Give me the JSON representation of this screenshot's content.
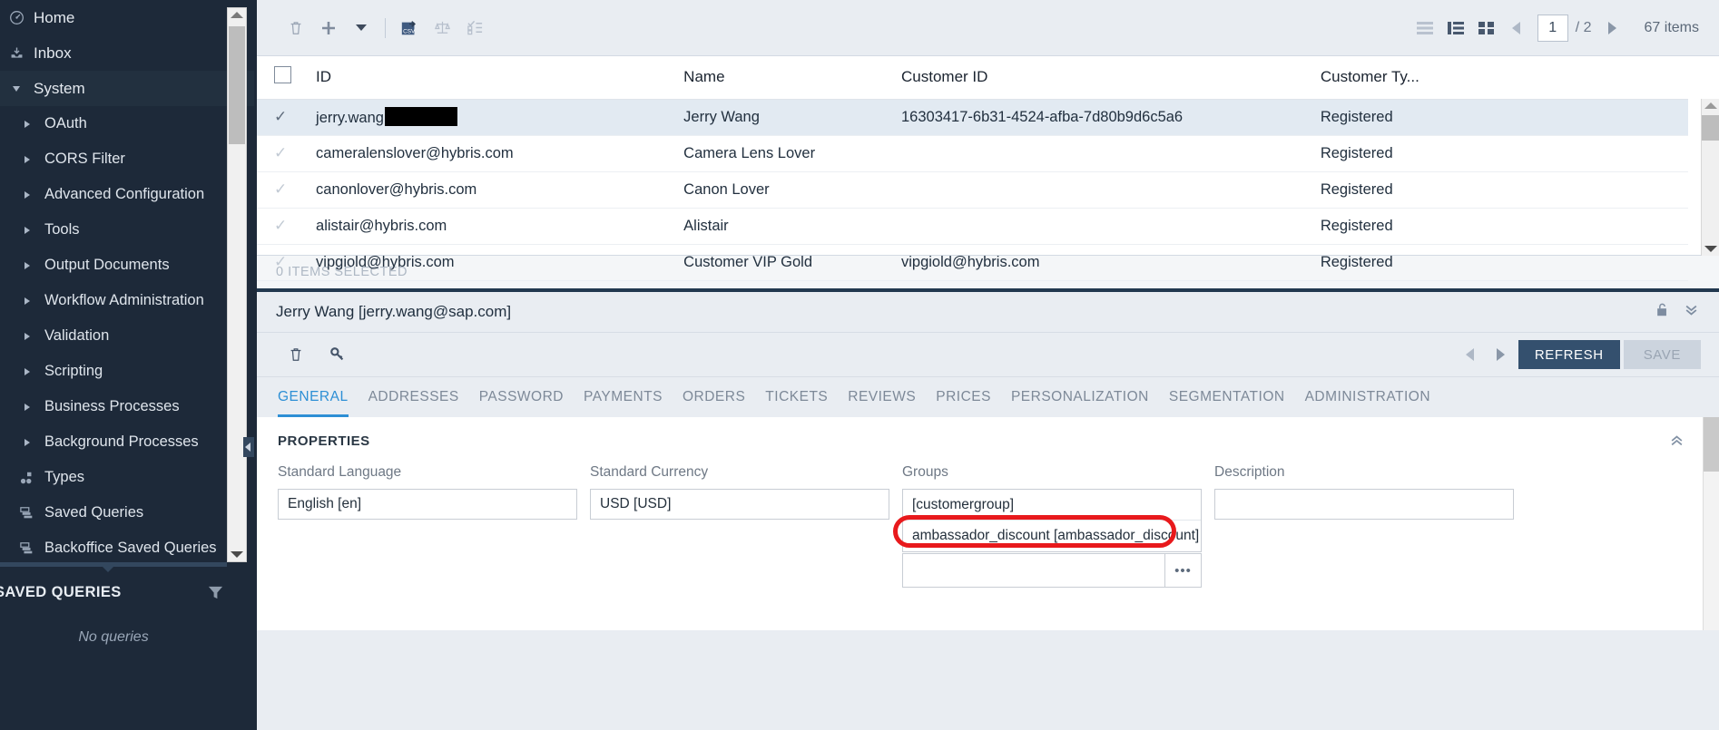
{
  "sidebar": {
    "items": [
      {
        "label": "Home",
        "icon": "home-icon",
        "level": 0,
        "expandable": false
      },
      {
        "label": "Inbox",
        "icon": "inbox-icon",
        "level": 0,
        "expandable": false
      },
      {
        "label": "System",
        "icon": "caret-down-icon",
        "level": 0,
        "expandable": true,
        "expanded": true
      },
      {
        "label": "OAuth",
        "icon": "caret-right-icon",
        "level": 1,
        "expandable": true
      },
      {
        "label": "CORS Filter",
        "icon": "caret-right-icon",
        "level": 1,
        "expandable": true
      },
      {
        "label": "Advanced Configuration",
        "icon": "caret-right-icon",
        "level": 1,
        "expandable": true
      },
      {
        "label": "Tools",
        "icon": "caret-right-icon",
        "level": 1,
        "expandable": true
      },
      {
        "label": "Output Documents",
        "icon": "caret-right-icon",
        "level": 1,
        "expandable": true
      },
      {
        "label": "Workflow Administration",
        "icon": "caret-right-icon",
        "level": 1,
        "expandable": true
      },
      {
        "label": "Validation",
        "icon": "caret-right-icon",
        "level": 1,
        "expandable": true
      },
      {
        "label": "Scripting",
        "icon": "caret-right-icon",
        "level": 1,
        "expandable": true
      },
      {
        "label": "Business Processes",
        "icon": "caret-right-icon",
        "level": 1,
        "expandable": true
      },
      {
        "label": "Background Processes",
        "icon": "caret-right-icon",
        "level": 1,
        "expandable": true
      },
      {
        "label": "Types",
        "icon": "types-icon",
        "level": 1,
        "expandable": false
      },
      {
        "label": "Saved Queries",
        "icon": "saved-queries-icon",
        "level": 1,
        "expandable": false
      },
      {
        "label": "Backoffice Saved Queries",
        "icon": "saved-queries-icon",
        "level": 1,
        "expandable": false
      }
    ],
    "saved_queries": {
      "title": "SAVED QUERIES",
      "filter_icon": "filter-funnel-icon",
      "empty_text": "No queries"
    }
  },
  "list_toolbar": {
    "buttons": [
      {
        "name": "delete-button",
        "icon": "trash-icon"
      },
      {
        "name": "create-button",
        "icon": "plus-icon"
      },
      {
        "name": "create-dropdown-button",
        "icon": "caret-down-icon"
      },
      {
        "name": "export-csv-button",
        "icon": "csv-export-icon",
        "label": "CSV"
      },
      {
        "name": "compare-button",
        "icon": "scales-icon"
      },
      {
        "name": "checklist-button",
        "icon": "checklist-icon"
      }
    ],
    "views": [
      {
        "name": "list-view-button",
        "icon": "list-view-icon"
      },
      {
        "name": "tree-view-button",
        "icon": "tree-view-icon"
      },
      {
        "name": "grid-view-button",
        "icon": "grid-view-icon"
      }
    ],
    "pagination": {
      "prev_icon": "chevron-left-icon",
      "next_icon": "chevron-right-icon",
      "current_page": "1",
      "total_pages": "/ 2",
      "items_count": "67 items"
    }
  },
  "table": {
    "columns": [
      "ID",
      "Name",
      "Customer ID",
      "Customer Ty..."
    ],
    "rows": [
      {
        "id": "jerry.wang",
        "redacted": true,
        "name": "Jerry Wang",
        "customer_id": "16303417-6b31-4524-afba-7d80b9d6c5a6",
        "customer_type": "Registered",
        "selected": true
      },
      {
        "id": "cameralenslover@hybris.com",
        "redacted": false,
        "name": "Camera Lens Lover",
        "customer_id": "",
        "customer_type": "Registered",
        "selected": false
      },
      {
        "id": "canonlover@hybris.com",
        "redacted": false,
        "name": "Canon Lover",
        "customer_id": "",
        "customer_type": "Registered",
        "selected": false
      },
      {
        "id": "alistair@hybris.com",
        "redacted": false,
        "name": "Alistair",
        "customer_id": "",
        "customer_type": "Registered",
        "selected": false
      },
      {
        "id": "vipgiold@hybris.com",
        "redacted": false,
        "name": "Customer VIP Gold",
        "customer_id": "vipgiold@hybris.com",
        "customer_type": "Registered",
        "selected": false
      }
    ],
    "selection_status": "0 ITEMS SELECTED"
  },
  "detail": {
    "title": "Jerry Wang [jerry.wang@sap.com]",
    "lock_icon": "unlock-icon",
    "collapse_icon": "double-chevron-down-icon",
    "toolbar": {
      "delete_icon": "trash-icon",
      "password_icon": "key-icon",
      "prev_icon": "chevron-left-icon",
      "next_icon": "chevron-right-icon",
      "refresh_label": "REFRESH",
      "save_label": "SAVE"
    },
    "tabs": [
      {
        "label": "GENERAL",
        "active": true
      },
      {
        "label": "ADDRESSES",
        "active": false
      },
      {
        "label": "PASSWORD",
        "active": false
      },
      {
        "label": "PAYMENTS",
        "active": false
      },
      {
        "label": "ORDERS",
        "active": false
      },
      {
        "label": "TICKETS",
        "active": false
      },
      {
        "label": "REVIEWS",
        "active": false
      },
      {
        "label": "PRICES",
        "active": false
      },
      {
        "label": "PERSONALIZATION",
        "active": false
      },
      {
        "label": "SEGMENTATION",
        "active": false
      },
      {
        "label": "ADMINISTRATION",
        "active": false
      }
    ],
    "properties": {
      "section_title": "PROPERTIES",
      "collapse_icon": "double-chevron-up-icon",
      "standard_language": {
        "label": "Standard Language",
        "value": "English [en]"
      },
      "standard_currency": {
        "label": "Standard Currency",
        "value": "USD [USD]"
      },
      "groups": {
        "label": "Groups",
        "values": [
          "[customergroup]",
          "ambassador_discount [ambassador_discount]"
        ],
        "highlighted_index": 1,
        "input_value": "",
        "more_button_label": "•••"
      },
      "description": {
        "label": "Description",
        "value": ""
      }
    }
  },
  "colors": {
    "sidebar_bg": "#1d2939",
    "accent_blue": "#2d8fd5",
    "refresh_btn": "#34506e",
    "highlight_red": "#e8191c",
    "selected_row": "#e2eaf2"
  }
}
